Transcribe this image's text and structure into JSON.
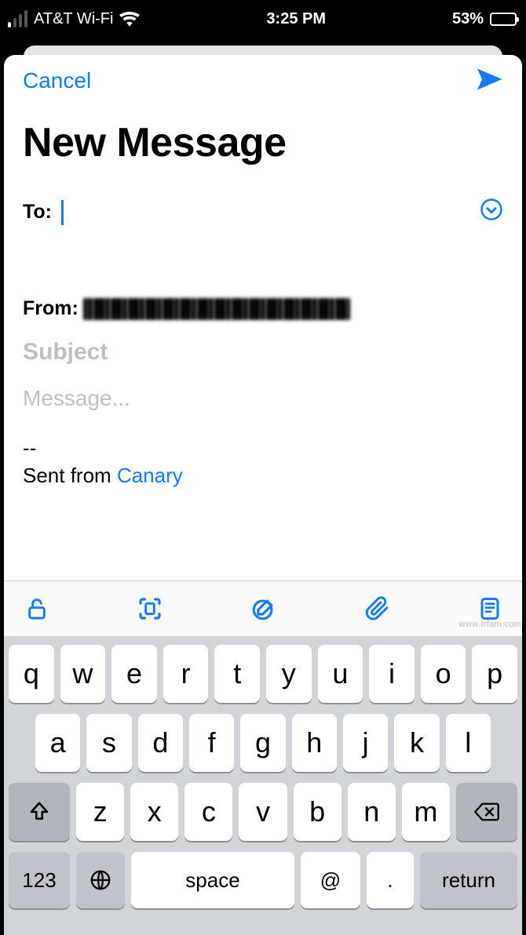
{
  "statusbar": {
    "carrier": "AT&T Wi-Fi",
    "time": "3:25 PM",
    "battery_pct": "53%",
    "battery_fill_css": "53%"
  },
  "nav": {
    "cancel": "Cancel"
  },
  "compose": {
    "title": "New Message",
    "to_label": "To:",
    "from_label": "From:",
    "from_value_redacted": true,
    "subject_placeholder": "Subject",
    "message_placeholder": "Message...",
    "signature_divider": "--",
    "signature_prefix": "Sent from ",
    "signature_link": "Canary"
  },
  "toolbar_icons": [
    "lock-open-icon",
    "scan-icon",
    "compose-circle-icon",
    "paperclip-icon",
    "template-icon"
  ],
  "keyboard": {
    "row1": [
      "q",
      "w",
      "e",
      "r",
      "t",
      "y",
      "u",
      "i",
      "o",
      "p"
    ],
    "row2": [
      "a",
      "s",
      "d",
      "f",
      "g",
      "h",
      "j",
      "k",
      "l"
    ],
    "row3": [
      "z",
      "x",
      "c",
      "v",
      "b",
      "n",
      "m"
    ],
    "num_label": "123",
    "space_label": "space",
    "at_label": "@",
    "dot_label": ".",
    "return_label": "return"
  },
  "watermark": "www.frfam.com"
}
